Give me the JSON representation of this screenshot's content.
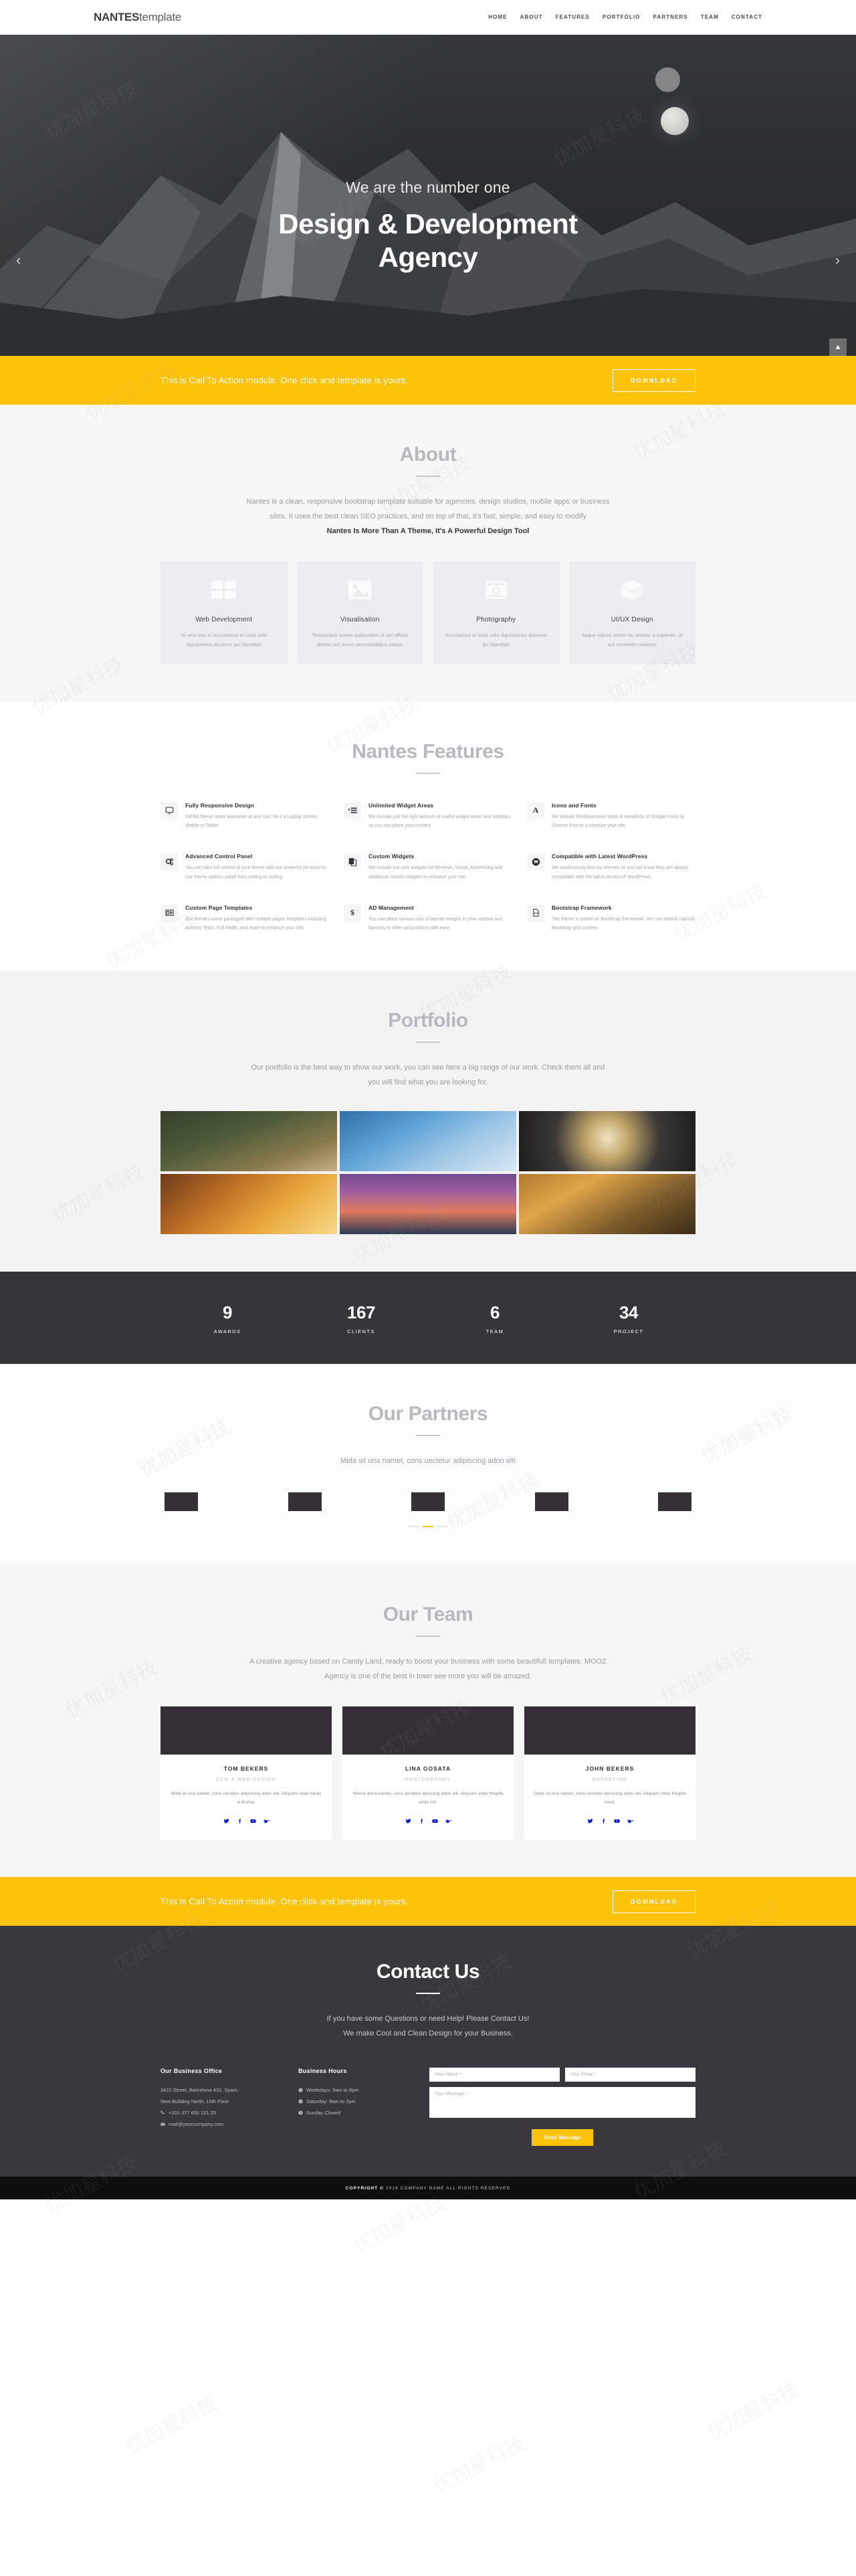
{
  "brand": {
    "bold": "NANTES",
    "light": "template"
  },
  "nav": {
    "items": [
      "HOME",
      "ABOUT",
      "FEATURES",
      "PORTFOLIO",
      "PARTNERS",
      "TEAM",
      "CONTACT"
    ]
  },
  "hero": {
    "subtitle": "We are the number one",
    "title_line1": "Design & Development",
    "title_line2": "Agency",
    "prev": "‹",
    "next": "›"
  },
  "cta": {
    "text": "This is Call To Action module. One click and template is yours.",
    "button": "DOWNLOAD",
    "scrolltop": "▲"
  },
  "about": {
    "title": "About",
    "lede_line1": "Nantes is a clean, responsive bootstrap template suitable for agencies, design studios, mobile apps or business",
    "lede_line2": "sites. It uses the best clean SEO practices, and on top of that, it's fast, simple, and easy to modify",
    "lede_bold": "Nantes Is More Than A Theme, It's A Powerful Design Tool",
    "cards": [
      {
        "icon": "browser-window-icon",
        "title": "Web Development",
        "text": "At vero eos et accusamus et iusto odio dignissimos ducimus qui blanditiis"
      },
      {
        "icon": "image-picture-icon",
        "title": "Visualisation",
        "text": "Temporibus autem quibusdam et aut officiis debitis aut rerum necessitatibus saepe"
      },
      {
        "icon": "camera-icon",
        "title": "Photography",
        "text": "Accusamus et iusto odio dignissimos ducimus qui blanditiis"
      },
      {
        "icon": "cube-box-icon",
        "title": "UI/UX Design",
        "text": "Itaque earum rerum hic tenetur a sapiente, ut aut reiciendis maiores"
      }
    ]
  },
  "features": {
    "title": "Nantes Features",
    "items": [
      {
        "icon": "monitor-icon",
        "title": "Fully Responsive Design",
        "text": "INFRA theme looks awesome at any size, be it a Laptop screen, Mobile or Tablet."
      },
      {
        "icon": "list-widget-icon",
        "title": "Unlimited Widget Areas",
        "text": "We include just the right amount of useful widget areas and sidebars so you can place your content."
      },
      {
        "icon": "font-letter-a-icon",
        "title": "Icons and Fonts",
        "text": "We include FontAwesome Icons & Hundreds of Google Fonts to Choose from to customize your site."
      },
      {
        "icon": "gears-icon",
        "title": "Advanced Control Panel",
        "text": "You can take full control of your theme with our powerful yet easy-to-use theme options panel from setting to styling."
      },
      {
        "icon": "copy-pages-icon",
        "title": "Custom Widgets",
        "text": "We include our own widgets for Reviews, Social, Advertising and additional custom widgets to enhance your site."
      },
      {
        "icon": "wordpress-icon",
        "title": "Compatible with Latest WordPress",
        "text": "We continuously test our themes so you will know they are always compatible with the latest version of WordPress."
      },
      {
        "icon": "newspaper-icon",
        "title": "Custom Page Templates",
        "text": "Our themes come packaged with multiple pages templates including Authors Team, Full Width, and more to enhance your site."
      },
      {
        "icon": "dollar-sign-icon",
        "title": "AD Management",
        "text": "You can place various size of banner images in your sidebar and banners to other ad positions with ease."
      },
      {
        "icon": "code-file-icon",
        "title": "Bootstrap Framework",
        "text": "The theme is based on Bootstrap framework. We use default row/col-Bootstrap grid system."
      }
    ]
  },
  "portfolio": {
    "title": "Portfolio",
    "lede_line1": "Our portfolio is the best way to show our work, you can see here a big range of our work. Check them all and",
    "lede_line2": "you will find what you are looking for.",
    "items": [
      {
        "name": "woman-in-forest-photo"
      },
      {
        "name": "modern-building-photo"
      },
      {
        "name": "dome-ceiling-photo"
      },
      {
        "name": "woman-at-sunset-photo"
      },
      {
        "name": "boat-on-lake-photo"
      },
      {
        "name": "hands-sunset-photo"
      }
    ]
  },
  "stats": [
    {
      "number": "9",
      "label": "AWARDS"
    },
    {
      "number": "167",
      "label": "CLIENTS"
    },
    {
      "number": "6",
      "label": "TEAM"
    },
    {
      "number": "34",
      "label": "PROJECT"
    }
  ],
  "partners": {
    "title": "Our Partners",
    "lede": "Mida sit una namet, cons uectetur adipiscing adon elit",
    "logos": [
      "partner-logo-1",
      "partner-logo-2",
      "partner-logo-3",
      "partner-logo-4",
      "partner-logo-5"
    ],
    "active_dot": 1
  },
  "team": {
    "title": "Our Team",
    "lede_line1": "A creative agency based on Candy Land, ready to boost your business with some beautifull templates. MOOZ",
    "lede_line2": "Agency is one of the best in town see more you will be amazed.",
    "members": [
      {
        "name": "TOM BEKERS",
        "role": "CEO & WEB DESIGN",
        "text": "Mida sit una namet, cons uectetur adipiscing adon elit. Aliquam vitae baras a droma."
      },
      {
        "name": "LINA GOSATA",
        "role": "PHOTOGRAPHY",
        "text": "Worsa dona namet, cons uectetur dipiscing adon elit. Aliquam vitae fringilla unda mir."
      },
      {
        "name": "JOHN BEKERS",
        "role": "MARKETING",
        "text": "Dolor sit don namet, cons uectetur beriscing adon elit. Aliquam vitae fringilla unda."
      }
    ],
    "social": [
      "twitter-icon",
      "facebook-icon",
      "youtube-icon",
      "google-plus-icon"
    ]
  },
  "cta2": {
    "text": "This is Call To Action module. One click and template is yours.",
    "button": "DOWNLOAD"
  },
  "contact": {
    "title": "Contact Us",
    "lede_line1": "If you have some Questions or need Help! Please Contact Us!",
    "lede_line2": "We make Cool and Clean Design for your Business.",
    "office": {
      "heading": "Our Business Office",
      "address_line1": "3422 Street, Barcelona 432, Spain,",
      "address_line2": "New Building North, 15th Floor",
      "phone": "+101 377 655 221 25",
      "email": "mail@yourcompany.com"
    },
    "hours": {
      "heading": "Business Hours",
      "items": [
        "Weekdays: 9am to 8pm",
        "Saturday: 9am to 2pm",
        "Sunday Closed"
      ]
    },
    "form": {
      "name_placeholder": "Your Name *",
      "email_placeholder": "Your Email *",
      "message_placeholder": "Your Message *",
      "submit": "Send Message"
    }
  },
  "footer": {
    "copyright_pre": "COPYRIGHT",
    "symbol": "©",
    "copyright_post": "2019 COMPANY NAME ALL RIGHTS RESERVED"
  },
  "colors": {
    "accent": "#fdc30b",
    "dark": "#37343a",
    "darker": "#0e0e0f",
    "muted": "#b8b8c0"
  }
}
